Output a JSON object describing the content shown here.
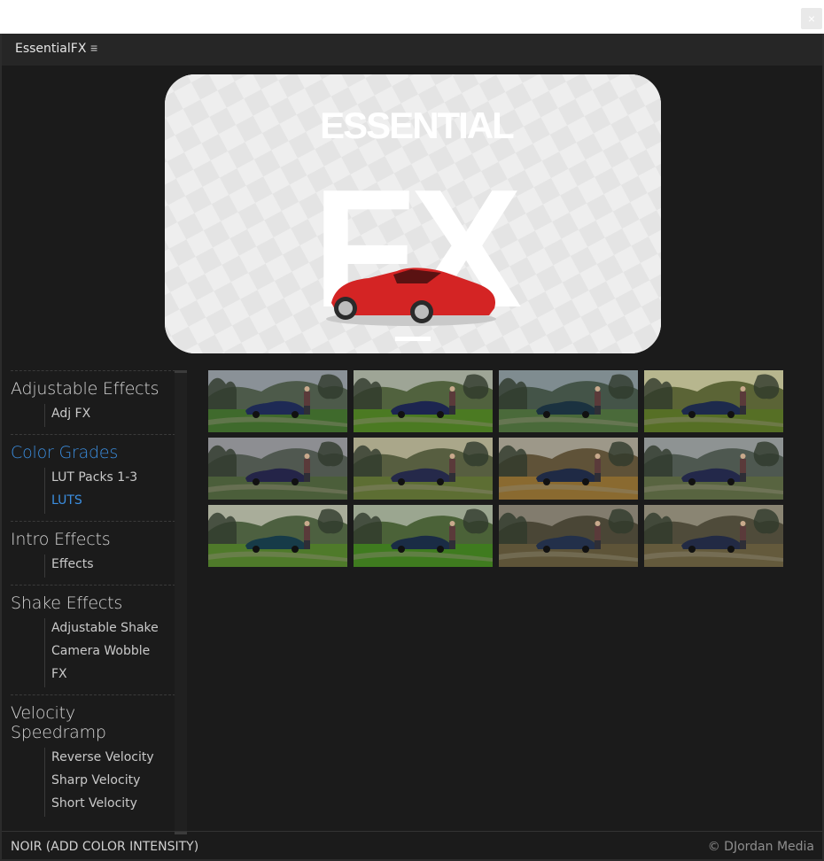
{
  "window": {
    "close_label": "×"
  },
  "panel": {
    "title": "EssentialFX",
    "menu_icon": "≡"
  },
  "hero": {
    "wordmark_top": "ESSENTIAL",
    "wordmark_big": "FX",
    "car_color": "#d42424"
  },
  "sidebar": {
    "groups": [
      {
        "title": "Adjustable Effects",
        "active": false,
        "items": [
          {
            "label": "Adj FX",
            "active": false
          }
        ]
      },
      {
        "title": "Color Grades",
        "active": true,
        "items": [
          {
            "label": "LUT Packs 1-3",
            "active": false
          },
          {
            "label": "LUTS",
            "active": true
          }
        ]
      },
      {
        "title": "Intro Effects",
        "active": false,
        "items": [
          {
            "label": "Effects",
            "active": false
          }
        ]
      },
      {
        "title": "Shake Effects",
        "active": false,
        "items": [
          {
            "label": "Adjustable Shake",
            "active": false
          },
          {
            "label": "Camera Wobble",
            "active": false
          },
          {
            "label": "FX",
            "active": false
          }
        ]
      },
      {
        "title": "Velocity Speedramp",
        "active": false,
        "items": [
          {
            "label": "Reverse Velocity",
            "active": false
          },
          {
            "label": "Sharp Velocity",
            "active": false
          },
          {
            "label": "Short Velocity",
            "active": false
          }
        ]
      }
    ]
  },
  "thumbnails": [
    {
      "sky": "#8a9197",
      "hills": "#4d5a4a",
      "grass": "#3f6a2c",
      "car": "#1e2a55"
    },
    {
      "sky": "#9ea596",
      "hills": "#51623e",
      "grass": "#4b7a22",
      "car": "#1c2550"
    },
    {
      "sky": "#7f8c90",
      "hills": "#445448",
      "grass": "#4a6a3a",
      "car": "#1b3240"
    },
    {
      "sky": "#b7b68e",
      "hills": "#5b6436",
      "grass": "#566f25",
      "car": "#1d2a4c"
    },
    {
      "sky": "#8d8e92",
      "hills": "#505850",
      "grass": "#4b5e3a",
      "car": "#242448"
    },
    {
      "sky": "#aaa78a",
      "hills": "#575e40",
      "grass": "#5d6e33",
      "car": "#25294a"
    },
    {
      "sky": "#9d9889",
      "hills": "#5f5238",
      "grass": "#8a6a30",
      "car": "#1f2a45"
    },
    {
      "sky": "#8e9393",
      "hills": "#4e5850",
      "grass": "#586440",
      "car": "#23284a"
    },
    {
      "sky": "#a9ad9a",
      "hills": "#4d6040",
      "grass": "#4f7a2a",
      "car": "#173b48"
    },
    {
      "sky": "#9ba690",
      "hills": "#4b6238",
      "grass": "#3f7b1f",
      "car": "#1a2c45"
    },
    {
      "sky": "#827c6e",
      "hills": "#4a4636",
      "grass": "#5e5438",
      "car": "#23304a"
    },
    {
      "sky": "#8a8573",
      "hills": "#4f4b3a",
      "grass": "#645a3c",
      "car": "#222a44"
    }
  ],
  "footer": {
    "selection": "NOIR (ADD COLOR INTENSITY)",
    "credit": "© DJordan Media"
  }
}
